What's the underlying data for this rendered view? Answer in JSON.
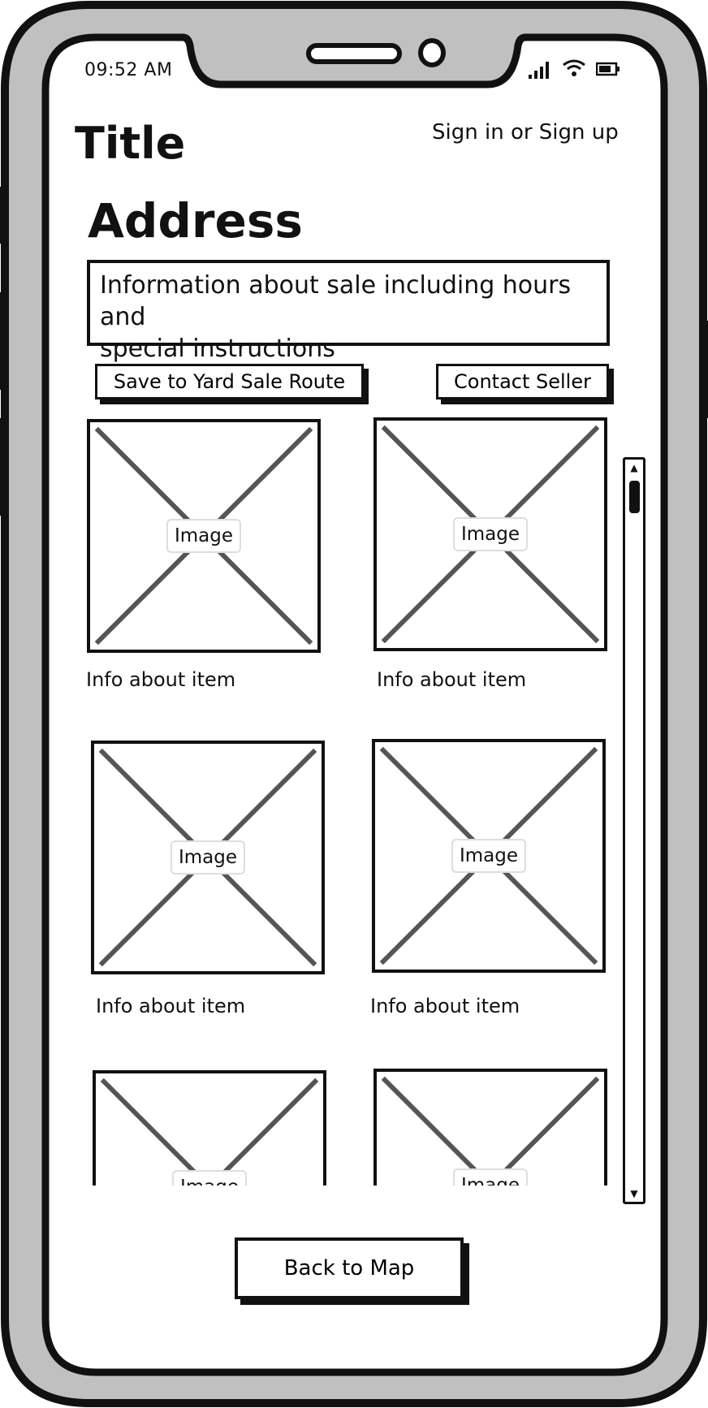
{
  "status_bar": {
    "time": "09:52 AM",
    "icons": [
      "signal-icon",
      "wifi-icon",
      "battery-icon"
    ]
  },
  "header": {
    "title": "Title",
    "auth_link": "Sign in or Sign up"
  },
  "sale": {
    "address": "Address",
    "info_line1": "Information about sale including hours and",
    "info_line2": "special instructions"
  },
  "actions": {
    "save_label": "Save to Yard Sale Route",
    "contact_label": "Contact Seller"
  },
  "items": [
    {
      "image_label": "Image",
      "info": "Info about item"
    },
    {
      "image_label": "Image",
      "info": "Info about item"
    },
    {
      "image_label": "Image",
      "info": "Info about item"
    },
    {
      "image_label": "Image",
      "info": "Info about item"
    },
    {
      "image_label": "Image",
      "info": ""
    },
    {
      "image_label": "Image",
      "info": ""
    }
  ],
  "footer": {
    "back_label": "Back to Map"
  },
  "colors": {
    "frame": "#c0c0c0",
    "ink": "#111111",
    "placeholder_cross": "#555555"
  }
}
